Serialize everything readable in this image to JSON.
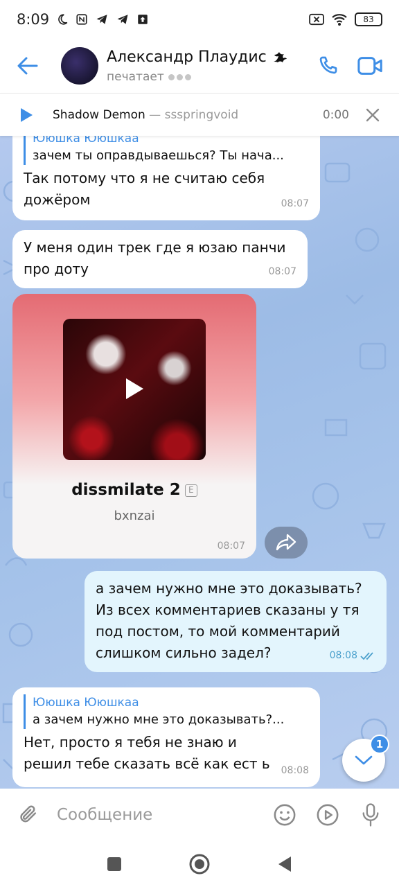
{
  "status_bar": {
    "time": "8:09",
    "battery": "83"
  },
  "header": {
    "name": "Александр Плаудис",
    "status": "печатает"
  },
  "player": {
    "title": "Shadow Demon",
    "separator": " — ",
    "performer": "ssspringvoid",
    "time": "0:00"
  },
  "messages": [
    {
      "reply_name": "Ююшка Ююшкаа",
      "reply_text": "зачем ты оправдываешься? Ты нача...",
      "text": "Так потому что я не считаю себя дожёром",
      "time": "08:07"
    },
    {
      "text": "У меня один трек где я юзаю панчи про доту",
      "time": "08:07"
    },
    {
      "song_title": "dissmilate 2",
      "explicit": "E",
      "artist": "bxnzai",
      "time": "08:07"
    },
    {
      "text": "а зачем нужно мне это доказывать? Из всех комментариев сказаны у тя под постом, то мой комментарий слишком сильно задел?",
      "time": "08:08"
    },
    {
      "reply_name": "Ююшка Ююшкаа",
      "reply_text": "а зачем нужно мне это доказывать?...",
      "text": "Нет, просто я тебя не знаю и решил тебе сказать всё как ест ь",
      "time": "08:08"
    }
  ],
  "unread_badge": "1",
  "composer": {
    "placeholder": "Сообщение"
  },
  "colors": {
    "accent": "#3e8ee6",
    "outgoing_bubble": "#e3f5fd",
    "chat_bg": "#a6c3ea"
  }
}
